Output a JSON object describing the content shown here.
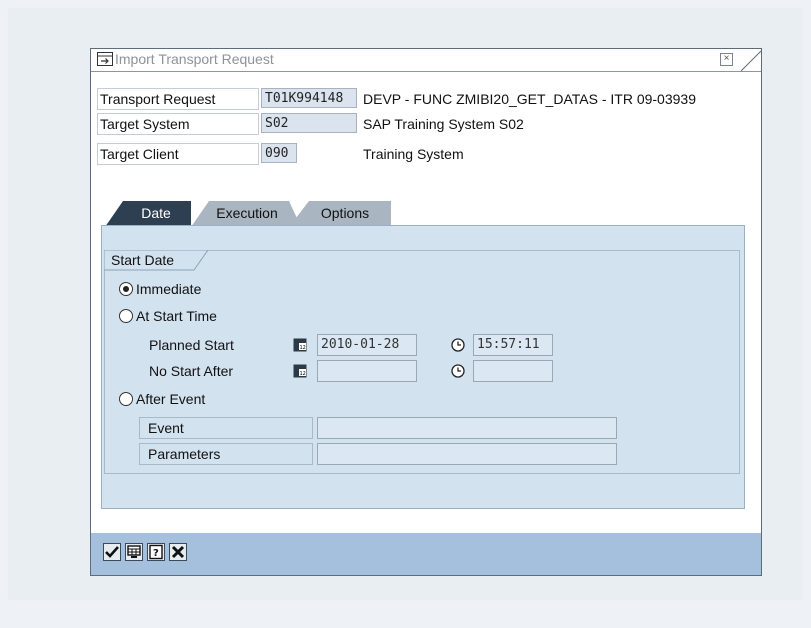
{
  "dialog": {
    "title": "Import Transport Request",
    "close_glyph": "×"
  },
  "header_fields": [
    {
      "label": "Transport Request",
      "value": "T01K994148",
      "description": "DEVP - FUNC ZMIBI20_GET_DATAS - ITR 09-03939"
    },
    {
      "label": "Target System",
      "value": "S02",
      "description": "SAP Training System S02"
    },
    {
      "label": "Target Client",
      "value": "090",
      "description": "Training System"
    }
  ],
  "tabs": [
    {
      "label": "Date",
      "active": true
    },
    {
      "label": "Execution",
      "active": false
    },
    {
      "label": "Options",
      "active": false
    }
  ],
  "start_date": {
    "group_title": "Start Date",
    "immediate_label": "Immediate",
    "at_start_time_label": "At Start Time",
    "planned_start_label": "Planned Start",
    "planned_start_date": "2010-01-28",
    "planned_start_time": "15:57:11",
    "no_start_after_label": "No Start After",
    "no_start_after_date": "",
    "no_start_after_time": "",
    "after_event_label": "After Event",
    "event_label": "Event",
    "event_value": "",
    "parameters_label": "Parameters",
    "parameters_value": "",
    "selected": "immediate"
  },
  "toolbar": {
    "buttons": [
      "check-icon",
      "schedule-icon",
      "help-icon",
      "cancel-icon"
    ]
  },
  "colors": {
    "toolbar_bg": "#a4c0dc",
    "panel_bg": "#d3e2ef",
    "active_tab": "#2e3f52"
  }
}
